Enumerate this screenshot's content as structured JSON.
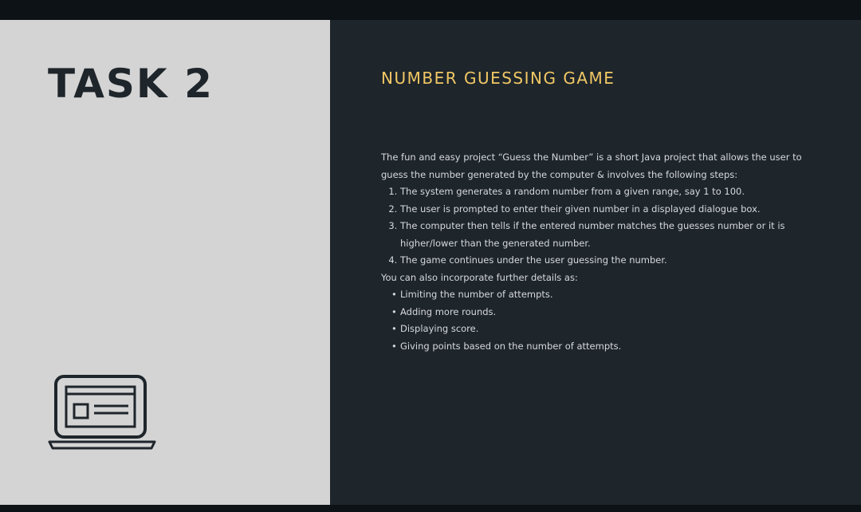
{
  "slide": {
    "title": "TASK 2",
    "icon": "laptop-icon",
    "colors": {
      "left_panel": "#d4d4d4",
      "right_panel": "#1e252b",
      "accent": "#f2c865",
      "body_text": "#d6d9dc"
    }
  },
  "content": {
    "heading": "NUMBER GUESSING GAME",
    "intro": "The fun and easy project “Guess the Number” is a short Java project that allows the user to guess the number generated by the computer & involves the following steps:",
    "steps": [
      "The system generates a random number from a given range, say 1 to 100.",
      "The user is prompted to enter their given number in a displayed dialogue box.",
      "The computer then tells if the entered number matches the guesses number or it is higher/lower than the generated number.",
      "The game continues under the user guessing the number."
    ],
    "further_intro": "You can also incorporate further details as:",
    "further_items": [
      "Limiting the number of attempts.",
      "Adding more rounds.",
      "Displaying score.",
      "Giving points based on the number of attempts."
    ]
  }
}
